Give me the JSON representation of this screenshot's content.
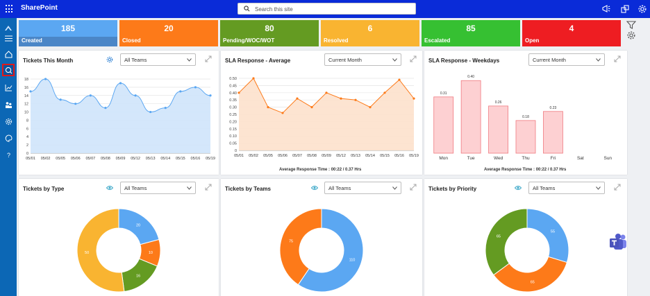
{
  "app": {
    "title": "SharePoint"
  },
  "search": {
    "placeholder": "Search this site"
  },
  "tiles": [
    {
      "value": "185",
      "label": "Created",
      "color": "#5ba7f2",
      "bar": "#4b86c7"
    },
    {
      "value": "20",
      "label": "Closed",
      "color": "#fd7a19",
      "bar": "#fd7a19"
    },
    {
      "value": "80",
      "label": "Pending/WOC/WOT",
      "color": "#649b22",
      "bar": "#649b22"
    },
    {
      "value": "6",
      "label": "Resolved",
      "color": "#f9b431",
      "bar": "#f9b431"
    },
    {
      "value": "85",
      "label": "Escalated",
      "color": "#36c032",
      "bar": "#36c032"
    },
    {
      "value": "4",
      "label": "Open",
      "color": "#ee1d22",
      "bar": "#ee1d22"
    }
  ],
  "panels": {
    "tickets_month": {
      "title": "Tickets This Month",
      "dropdown": "All Teams"
    },
    "sla_avg": {
      "title": "SLA Response - Average",
      "dropdown": "Current Month",
      "caption": "Average Response Time : 00:22 / 0.37 Hrs"
    },
    "sla_week": {
      "title": "SLA Response - Weekdays",
      "dropdown": "Current Month",
      "caption": "Average Response Time : 00:22 / 0.37 Hrs"
    },
    "by_type": {
      "title": "Tickets by Type",
      "dropdown": "All Teams"
    },
    "by_teams": {
      "title": "Tickets by Teams",
      "dropdown": "All Teams"
    },
    "by_priority": {
      "title": "Tickets by Priority",
      "dropdown": "All Teams"
    }
  },
  "chart_data": [
    {
      "type": "area",
      "title": "Tickets This Month",
      "x": [
        "05/01",
        "05/02",
        "05/05",
        "05/06",
        "05/07",
        "05/08",
        "05/09",
        "05/12",
        "05/13",
        "05/14",
        "05/15",
        "05/16",
        "05/19"
      ],
      "values": [
        15,
        18,
        13,
        12,
        14,
        11,
        17,
        14,
        10,
        11,
        15,
        16,
        14
      ],
      "ylim": [
        0,
        18
      ],
      "yticks": [
        0,
        2,
        4,
        6,
        8,
        10,
        12,
        14,
        16,
        18
      ],
      "color": "#5ba7f2",
      "grid": true
    },
    {
      "type": "area",
      "title": "SLA Response - Average",
      "x": [
        "05/01",
        "05/02",
        "05/05",
        "05/06",
        "05/07",
        "05/08",
        "05/09",
        "05/12",
        "05/13",
        "05/14",
        "05/15",
        "05/16",
        "05/19"
      ],
      "values": [
        0.4,
        0.5,
        0.3,
        0.26,
        0.36,
        0.3,
        0.4,
        0.36,
        0.35,
        0.3,
        0.4,
        0.49,
        0.36
      ],
      "ylim": [
        0,
        0.5
      ],
      "yticks": [
        "0",
        "0.05",
        "0.10",
        "0.15",
        "0.20",
        "0.25",
        "0.30",
        "0.35",
        "0.40",
        "0.45",
        "0.50"
      ],
      "color": "#fd7a19",
      "grid": true
    },
    {
      "type": "bar",
      "title": "SLA Response - Weekdays",
      "categories": [
        "Mon",
        "Tue",
        "Wed",
        "Thu",
        "Fri",
        "Sat",
        "Sun"
      ],
      "values": [
        0.31,
        0.4,
        0.26,
        0.18,
        0.23,
        null,
        null
      ],
      "data_labels": [
        "0.31",
        "0.40",
        "0.26",
        "0.18",
        "0.23",
        "",
        ""
      ],
      "ylim": [
        0,
        0.42
      ],
      "color": "#fdd0d2",
      "edge": "#f07a80"
    },
    {
      "type": "pie",
      "title": "Tickets by Type",
      "donut": true,
      "values": [
        20,
        10,
        16,
        50
      ],
      "labels": [
        "20",
        "10",
        "16",
        "50"
      ],
      "colors": [
        "#5ba7f2",
        "#fd7a19",
        "#649b22",
        "#f9b431"
      ]
    },
    {
      "type": "pie",
      "title": "Tickets by Teams",
      "donut": true,
      "values": [
        110,
        75
      ],
      "labels": [
        "110",
        "75"
      ],
      "colors": [
        "#5ba7f2",
        "#fd7a19"
      ]
    },
    {
      "type": "pie",
      "title": "Tickets by Priority",
      "donut": true,
      "values": [
        55,
        65,
        65
      ],
      "labels": [
        "55",
        "65",
        "65"
      ],
      "colors": [
        "#5ba7f2",
        "#fd7a19",
        "#649b22"
      ]
    }
  ]
}
